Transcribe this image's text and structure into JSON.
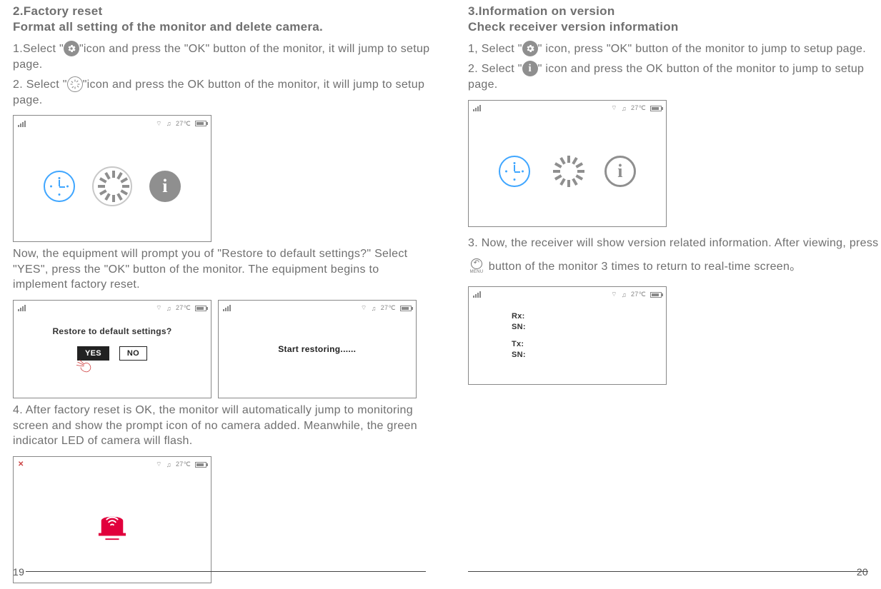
{
  "left": {
    "title": "2.Factory reset",
    "subtitle": "Format all setting of the monitor and delete camera.",
    "step1_a": "1.Select \"",
    "step1_b": "\"icon and press the \"OK\" button of the monitor, it will jump to setup page.",
    "step2_a": "2. Select \"",
    "step2_b": "\"icon and press the OK button of the monitor, it will jump to setup page.",
    "now_text": "Now, the equipment will prompt you of \"Restore to default settings?\" Select \"YES\", press the \"OK\" button of the monitor. The equipment begins to implement factory reset.",
    "restore_prompt": "Restore to default settings?",
    "yes": "YES",
    "no": "NO",
    "restoring": "Start restoring......",
    "step4": "4. After factory reset is OK, the monitor will automatically jump to monitoring screen and show the prompt icon of no camera added. Meanwhile, the green indicator LED of camera will flash."
  },
  "right": {
    "title": "3.Information on version",
    "subtitle": "Check receiver version information",
    "step1_a": "1, Select \"",
    "step1_b": "\" icon, press \"OK\" button of the monitor to jump to setup page.",
    "step2_a": "2. Select \"",
    "step2_b": "\" icon and press the OK button of the monitor to jump to setup page.",
    "step3_a": "3. Now, the receiver will show version related information. After viewing, press ",
    "step3_b": " button of the monitor 3 times to return to real-time screen。",
    "menu_label": "MENU",
    "version": {
      "rx": "Rx:",
      "sn1": "SN:",
      "tx": "Tx:",
      "sn2": "SN:"
    }
  },
  "status_temp": "27℃",
  "page_left_num": "19",
  "page_right_num": "20"
}
